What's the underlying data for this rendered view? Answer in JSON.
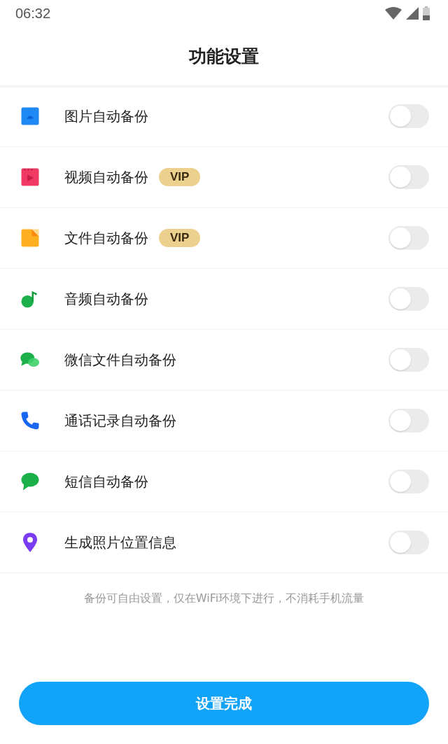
{
  "status_bar": {
    "time": "06:32"
  },
  "header": {
    "title": "功能设置"
  },
  "settings": [
    {
      "kind": "image",
      "label": "图片自动备份",
      "on": false
    },
    {
      "kind": "video",
      "label": "视频自动备份",
      "badge": "VIP",
      "on": false
    },
    {
      "kind": "file",
      "label": "文件自动备份",
      "badge": "VIP",
      "on": false
    },
    {
      "kind": "audio",
      "label": "音频自动备份",
      "on": false
    },
    {
      "kind": "wechat",
      "label": "微信文件自动备份",
      "on": false
    },
    {
      "kind": "phone",
      "label": "通话记录自动备份",
      "on": false
    },
    {
      "kind": "sms",
      "label": "短信自动备份",
      "on": false
    },
    {
      "kind": "location",
      "label": "生成照片位置信息",
      "on": false
    }
  ],
  "note": "备份可自由设置，仅在WiFi环境下进行，不消耗手机流量",
  "done_button": "设置完成"
}
